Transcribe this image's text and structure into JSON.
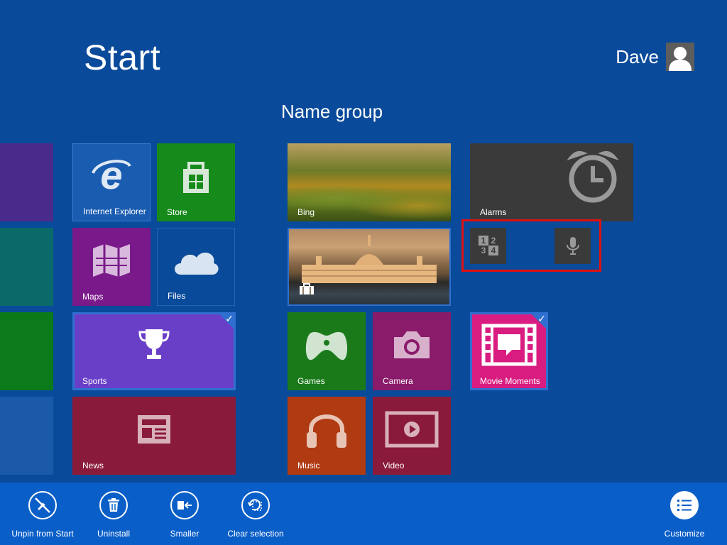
{
  "header": {
    "title": "Start",
    "user_name": "Dave"
  },
  "group": {
    "name": "Name group"
  },
  "tiles": {
    "internet_explorer": "Internet Explorer",
    "store": "Store",
    "maps": "Maps",
    "files": "Files",
    "sports": "Sports",
    "news": "News",
    "bing": "Bing",
    "alarms": "Alarms",
    "calculator_glyph": {
      "a": "1",
      "b": "2",
      "c": "3",
      "d": "4"
    },
    "games": "Games",
    "camera": "Camera",
    "movie_moments": "Movie Moments",
    "music": "Music",
    "video": "Video"
  },
  "appbar": {
    "unpin": "Unpin from Start",
    "uninstall": "Uninstall",
    "smaller": "Smaller",
    "clear_selection": "Clear selection",
    "customize": "Customize"
  },
  "colors": {
    "background": "#0a4a9a",
    "appbar": "#0a5ec8",
    "selection": "#2f6fd0",
    "highlight": "#e01010",
    "sports_tile": "#6a3fc8",
    "movie_moments_tile": "#d81c80"
  },
  "selection_check": "✓"
}
